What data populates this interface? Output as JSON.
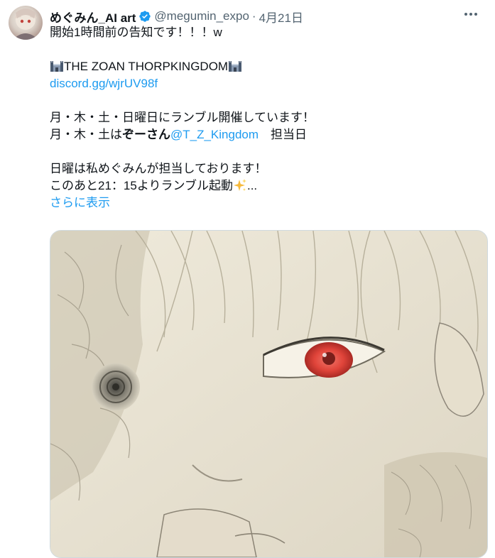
{
  "tweet": {
    "display_name": "めぐみん_AI art",
    "handle": "@megumin_expo",
    "separator": "·",
    "date": "4月21日",
    "text_line1": "開始1時間前の告知です！！！w",
    "server_name": "THE ZOAN THORPKINGDOM",
    "discord_link": "discord.gg/wjrUV98f",
    "schedule_line": "月・木・土・日曜日にランブル開催しています！",
    "assign_prefix": "月・木・土は",
    "assign_name": "ぞーさん",
    "assign_mention": "@T_Z_Kingdom",
    "assign_suffix": "　担当日",
    "sunday_line": "日曜は私めぐみんが担当しております！",
    "start_line": "このあと21：15よりランブル起動",
    "start_ellipsis": "...",
    "show_more": "さらに表示",
    "media_description_icon": "illustration-eye-red"
  },
  "colors": {
    "accent": "#1d9bf0",
    "text": "#0f1419",
    "muted": "#536471",
    "eye": "#e0443a"
  }
}
